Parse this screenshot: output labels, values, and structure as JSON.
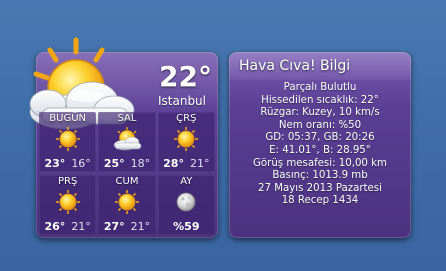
{
  "weather_widget": {
    "current_temp": "22°",
    "city": "Istanbul",
    "current_icon": "sun-behind-cloud-icon",
    "days": [
      {
        "day": "BUGÜN",
        "high": "23°",
        "low": "16°",
        "icon": "sun-icon"
      },
      {
        "day": "SAL",
        "high": "25°",
        "low": "18°",
        "icon": "sun-behind-cloud-icon"
      },
      {
        "day": "ÇRŞ",
        "high": "28°",
        "low": "21°",
        "icon": "sun-icon"
      },
      {
        "day": "PRŞ",
        "high": "26°",
        "low": "21°",
        "icon": "sun-icon"
      },
      {
        "day": "CUM",
        "high": "27°",
        "low": "21°",
        "icon": "sun-icon"
      }
    ],
    "moon": {
      "label": "AY",
      "value": "%59",
      "icon": "moon-icon"
    }
  },
  "info_widget": {
    "title": "Hava Cıva! Bilgi",
    "lines": [
      "Parçalı Bulutlu",
      "Hissedilen sıcaklık: 22°",
      "Rüzgar: Kuzey, 10 km/s",
      "Nem oranı: %50",
      "GD: 05:37, GB: 20:26",
      "E: 41.01°, B: 28.95°",
      "Görüş mesafesi: 10,00 km",
      "Basınç: 1013.9 mb",
      "27 Mayıs 2013 Pazartesi",
      "18 Recep 1434"
    ]
  },
  "colors": {
    "desktop": "#4270aa",
    "widget": "#5a3f93",
    "sun": "#f4b41a"
  }
}
